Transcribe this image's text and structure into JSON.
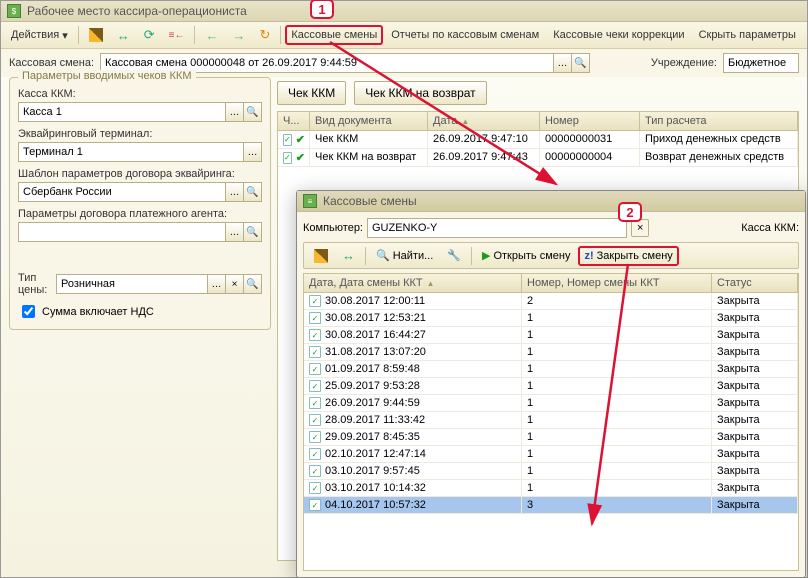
{
  "window": {
    "title": "Рабочее место кассира-операциониста"
  },
  "menu": {
    "actions": "Действия",
    "t_cash_shifts": "Кассовые смены",
    "t_reports": "Отчеты по кассовым сменам",
    "t_correction": "Кассовые чеки коррекции",
    "t_hide": "Скрыть параметры"
  },
  "form": {
    "cash_shift_label": "Кассовая смена:",
    "cash_shift_value": "Кассовая смена 000000048 от 26.09.2017 9:44:59",
    "org_label": "Учреждение:",
    "org_value": "Бюджетное"
  },
  "params": {
    "legend": "Параметры вводимых чеков ККМ",
    "kkm_label": "Касса ККМ:",
    "kkm_value": "Касса 1",
    "acq_label": "Эквайринговый терминал:",
    "acq_value": "Терминал 1",
    "tmpl_label": "Шаблон параметров договора эквайринга:",
    "tmpl_value": "Сбербанк России",
    "agent_label": "Параметры договора платежного агента:",
    "agent_value": "",
    "price_label": "Тип цены:",
    "price_value": "Розничная",
    "vat_label": "Сумма включает НДС"
  },
  "docbtns": {
    "btn_kkm": "Чек ККМ",
    "btn_ret": "Чек ККМ на возврат"
  },
  "doc_grid": {
    "headers": {
      "ch": "Ч...",
      "kind": "Вид документа",
      "date": "Дата",
      "num": "Номер",
      "type": "Тип расчета"
    },
    "rows": [
      {
        "kind": "Чек ККМ",
        "date": "26.09.2017 9:47:10",
        "num": "00000000031",
        "type": "Приход денежных средств"
      },
      {
        "kind": "Чек ККМ на возврат",
        "date": "26.09.2017 9:47:43",
        "num": "00000000004",
        "type": "Возврат денежных средств"
      }
    ]
  },
  "popup": {
    "title": "Кассовые смены",
    "computer_label": "Компьютер:",
    "computer_value": "GUZENKO-Y",
    "kkm_label": "Касса ККМ:",
    "find_btn": "Найти...",
    "open_shift": "Открыть смену",
    "close_shift": "Закрыть смену",
    "headers": {
      "date": "Дата, Дата смены ККТ",
      "num": "Номер, Номер смены ККТ",
      "status": "Статус"
    },
    "rows": [
      {
        "date": "30.08.2017 12:00:11",
        "num": "2",
        "status": "Закрыта"
      },
      {
        "date": "30.08.2017 12:53:21",
        "num": "1",
        "status": "Закрыта"
      },
      {
        "date": "30.08.2017 16:44:27",
        "num": "1",
        "status": "Закрыта"
      },
      {
        "date": "31.08.2017 13:07:20",
        "num": "1",
        "status": "Закрыта"
      },
      {
        "date": "01.09.2017 8:59:48",
        "num": "1",
        "status": "Закрыта"
      },
      {
        "date": "25.09.2017 9:53:28",
        "num": "1",
        "status": "Закрыта"
      },
      {
        "date": "26.09.2017 9:44:59",
        "num": "1",
        "status": "Закрыта"
      },
      {
        "date": "28.09.2017 11:33:42",
        "num": "1",
        "status": "Закрыта"
      },
      {
        "date": "29.09.2017 8:45:35",
        "num": "1",
        "status": "Закрыта"
      },
      {
        "date": "02.10.2017 12:47:14",
        "num": "1",
        "status": "Закрыта"
      },
      {
        "date": "03.10.2017 9:57:45",
        "num": "1",
        "status": "Закрыта"
      },
      {
        "date": "03.10.2017 10:14:32",
        "num": "1",
        "status": "Закрыта"
      },
      {
        "date": "04.10.2017 10:57:32",
        "num": "3",
        "status": "Закрыта"
      }
    ]
  },
  "callouts": {
    "c1": "1",
    "c2": "2"
  }
}
